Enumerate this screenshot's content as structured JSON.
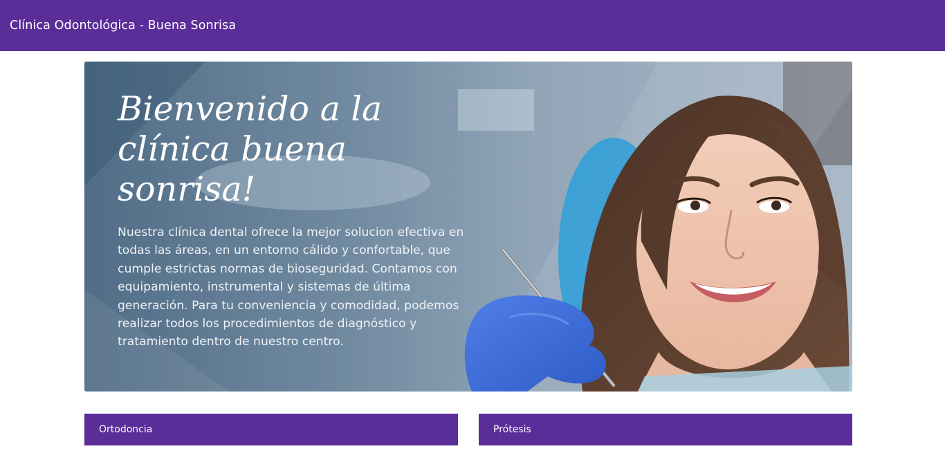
{
  "navbar": {
    "brand": "Clínica Odontológica - Buena Sonrisa",
    "background_color": "#5a2d98"
  },
  "hero": {
    "title": "Bienvenido a la clínica buena sonrisa!",
    "description": "Nuestra clínica dental ofrece la mejor solucion efectiva en todas las áreas, en un entorno cálido y confortable, que cumple estrictas normas de bioseguridad. Contamos con equipamiento, instrumental y sistemas de última generación. Para tu conveniencia y comodidad, podemos realizar todos los procedimientos de diagnóstico y tratamiento dentro de nuestro centro.",
    "image": "smiling-patient-dental-photo"
  },
  "cards": [
    {
      "title": "Ortodoncia"
    },
    {
      "title": "Prótesis"
    }
  ],
  "colors": {
    "primary": "#5a2d98",
    "hero_text": "#ffffff"
  }
}
